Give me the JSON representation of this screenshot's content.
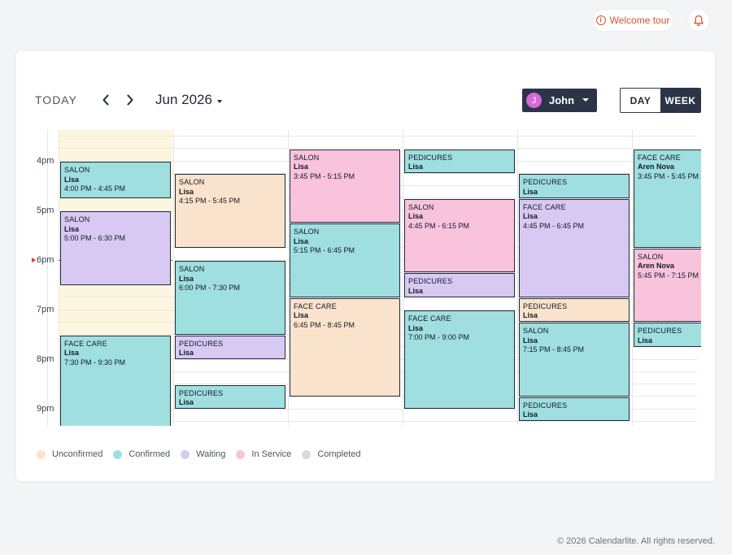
{
  "topbar": {
    "welcome_tour_label": "Welcome tour",
    "welcome_icon": "info-icon",
    "bell_icon": "bell-icon"
  },
  "header": {
    "today_label": "TODAY",
    "month_label": "Jun 2026",
    "user": {
      "initial": "J",
      "name": "John"
    },
    "views": {
      "day": "DAY",
      "week": "WEEK",
      "selected": "WEEK"
    }
  },
  "calendar": {
    "hours": [
      "4pm",
      "5pm",
      "6pm",
      "7pm",
      "8pm",
      "9pm"
    ],
    "status_colors": {
      "unconfirmed": "#fae3cc",
      "confirmed": "#a0dfdf",
      "waiting": "#d8c9f3",
      "in_service": "#f9c3dc",
      "completed": "#d9d9d9"
    },
    "appointments": [
      {
        "service": "SALON",
        "client": "Lisa",
        "time": "4:00 PM - 4:45 PM"
      },
      {
        "service": "SALON",
        "client": "Lisa",
        "time": "5:00 PM - 6:30 PM"
      },
      {
        "service": "FACE CARE",
        "client": "Lisa",
        "time": "7:30 PM - 9:30 PM"
      },
      {
        "service": "SALON",
        "client": "Lisa",
        "time": "4:15 PM - 5:45 PM"
      },
      {
        "service": "SALON",
        "client": "Lisa",
        "time": "6:00 PM - 7:30 PM"
      },
      {
        "service": "PEDICURES",
        "client": "Lisa",
        "time": ""
      },
      {
        "service": "PEDICURES",
        "client": "Lisa",
        "time": ""
      },
      {
        "service": "SALON",
        "client": "Lisa",
        "time": "3:45 PM - 5:15 PM"
      },
      {
        "service": "SALON",
        "client": "Lisa",
        "time": "5:15 PM - 6:45 PM"
      },
      {
        "service": "FACE CARE",
        "client": "Lisa",
        "time": "6:45 PM - 8:45 PM"
      },
      {
        "service": "PEDICURES",
        "client": "Lisa",
        "time": ""
      },
      {
        "service": "SALON",
        "client": "Lisa",
        "time": "4:45 PM - 6:15 PM"
      },
      {
        "service": "PEDICURES",
        "client": "Lisa",
        "time": ""
      },
      {
        "service": "FACE CARE",
        "client": "Lisa",
        "time": "7:00 PM - 9:00 PM"
      },
      {
        "service": "PEDICURES",
        "client": "Lisa",
        "time": ""
      },
      {
        "service": "FACE CARE",
        "client": "Lisa",
        "time": "4:45 PM - 6:45 PM"
      },
      {
        "service": "PEDICURES",
        "client": "Lisa",
        "time": ""
      },
      {
        "service": "SALON",
        "client": "Lisa",
        "time": "7:15 PM - 8:45 PM"
      },
      {
        "service": "PEDICURES",
        "client": "Lisa",
        "time": ""
      },
      {
        "service": "FACE CARE",
        "client": "Aren Nova",
        "time": "3:45 PM - 5:45 PM"
      },
      {
        "service": "SALON",
        "client": "Aren Nova",
        "time": "5:45 PM - 7:15 PM"
      },
      {
        "service": "PEDICURES",
        "client": "Lisa",
        "time": ""
      }
    ]
  },
  "legend": [
    {
      "label": "Unconfirmed",
      "color": "#fae3cc"
    },
    {
      "label": "Confirmed",
      "color": "#a0dfdf"
    },
    {
      "label": "Waiting",
      "color": "#d8c9f3"
    },
    {
      "label": "In Service",
      "color": "#f9c3dc"
    },
    {
      "label": "Completed",
      "color": "#d9d9d9"
    }
  ],
  "footer": {
    "copyright": "© 2026 Calendarlite. All rights reserved."
  }
}
